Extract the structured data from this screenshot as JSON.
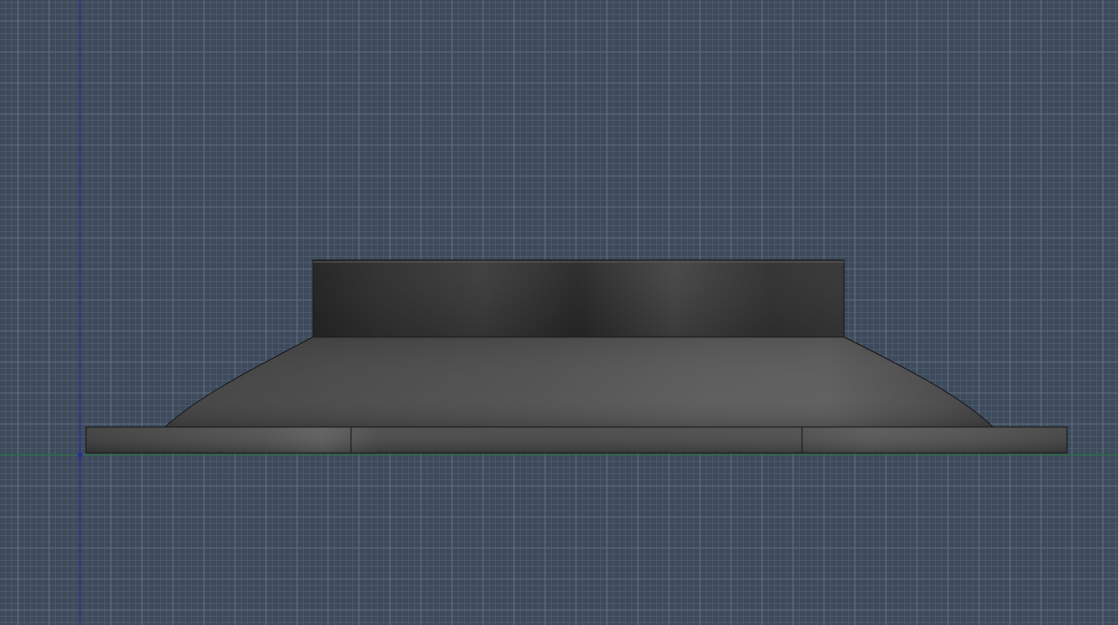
{
  "viewport": {
    "background_color": "#3c4a5c",
    "grid_minor_color": "#52606f",
    "grid_major_color": "#6b7888",
    "axis_x_color": "#2f6e4a",
    "axis_y_color": "#2a2f9a"
  },
  "model": {
    "body_color": "#4a4a4a",
    "edge_color": "#1b1b1b",
    "parts": [
      "base-plate",
      "tapered-skirt",
      "top-collar"
    ]
  }
}
